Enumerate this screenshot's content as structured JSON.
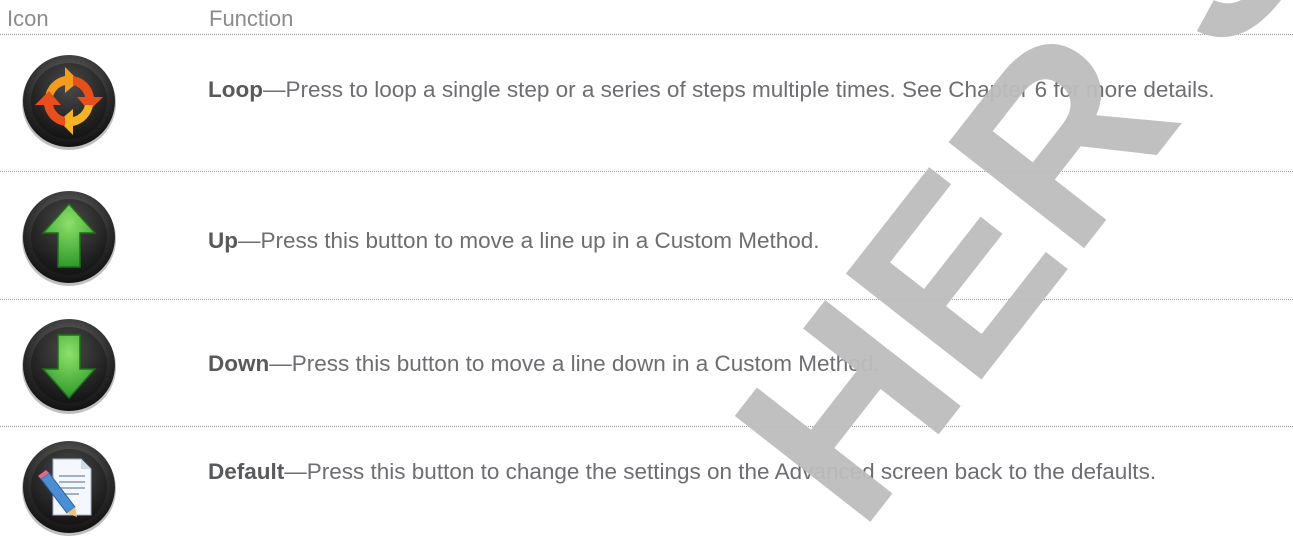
{
  "table": {
    "header": {
      "icon": "Icon",
      "function": "Function"
    },
    "rows": [
      {
        "icon": "loop-icon",
        "name": "Loop",
        "dash": "—",
        "text": "Press to loop a single step or a series of steps multiple times. See Chapter 6 for more details."
      },
      {
        "icon": "up-arrow-icon",
        "name": "Up",
        "dash": "—",
        "text": "Press this button to move a line up in a Custom Method."
      },
      {
        "icon": "down-arrow-icon",
        "name": "Down",
        "dash": "—",
        "text": "Press this button to move a line down in a Custom Method."
      },
      {
        "icon": "default-document-icon",
        "name": "Default",
        "dash": "—",
        "text": "Press this button to change the settings on the Advanced screen back to the defaults."
      }
    ]
  },
  "watermark": {
    "text": "HER SAS"
  },
  "colors": {
    "text": "#6d6e71",
    "header_text": "#8a8b8e",
    "watermark": "#bdbdbd",
    "arrow_green": "#3aaa35",
    "loop_orange": "#f39c1e",
    "loop_red": "#e94e1b"
  }
}
